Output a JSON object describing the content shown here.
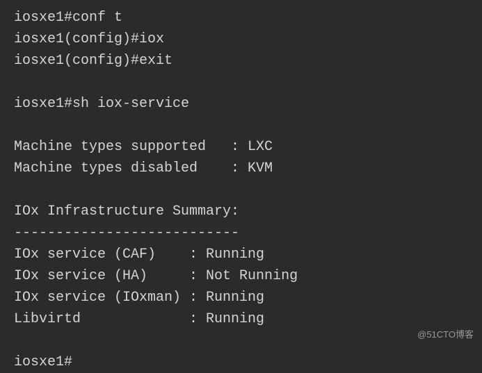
{
  "terminal": {
    "lines": [
      {
        "type": "cmd",
        "hostname": "iosxe1",
        "mode": "#",
        "modePrefix": "",
        "modeSuffix": "",
        "cmd": "conf t"
      },
      {
        "type": "cmd",
        "hostname": "iosxe1",
        "mode": "#",
        "modePrefix": "(config)",
        "modeSuffix": "",
        "cmd": "iox"
      },
      {
        "type": "cmd",
        "hostname": "iosxe1",
        "mode": "#",
        "modePrefix": "(config)",
        "modeSuffix": "",
        "cmd": "exit"
      },
      {
        "type": "blank"
      },
      {
        "type": "cmd",
        "hostname": "iosxe1",
        "mode": "#",
        "modePrefix": "",
        "modeSuffix": "",
        "cmd": "sh iox-service"
      },
      {
        "type": "blank"
      },
      {
        "type": "output",
        "text": "Machine types supported   : LXC"
      },
      {
        "type": "output",
        "text": "Machine types disabled    : KVM"
      },
      {
        "type": "blank"
      },
      {
        "type": "output",
        "text": "IOx Infrastructure Summary:"
      },
      {
        "type": "output",
        "text": "---------------------------"
      },
      {
        "type": "output",
        "text": "IOx service (CAF)    : Running"
      },
      {
        "type": "output",
        "text": "IOx service (HA)     : Not Running"
      },
      {
        "type": "output",
        "text": "IOx service (IOxman) : Running"
      },
      {
        "type": "output",
        "text": "Libvirtd             : Running"
      },
      {
        "type": "blank"
      },
      {
        "type": "cmd",
        "hostname": "iosxe1",
        "mode": "#",
        "modePrefix": "",
        "modeSuffix": "",
        "cmd": ""
      }
    ]
  },
  "watermark": "@51CTO博客"
}
